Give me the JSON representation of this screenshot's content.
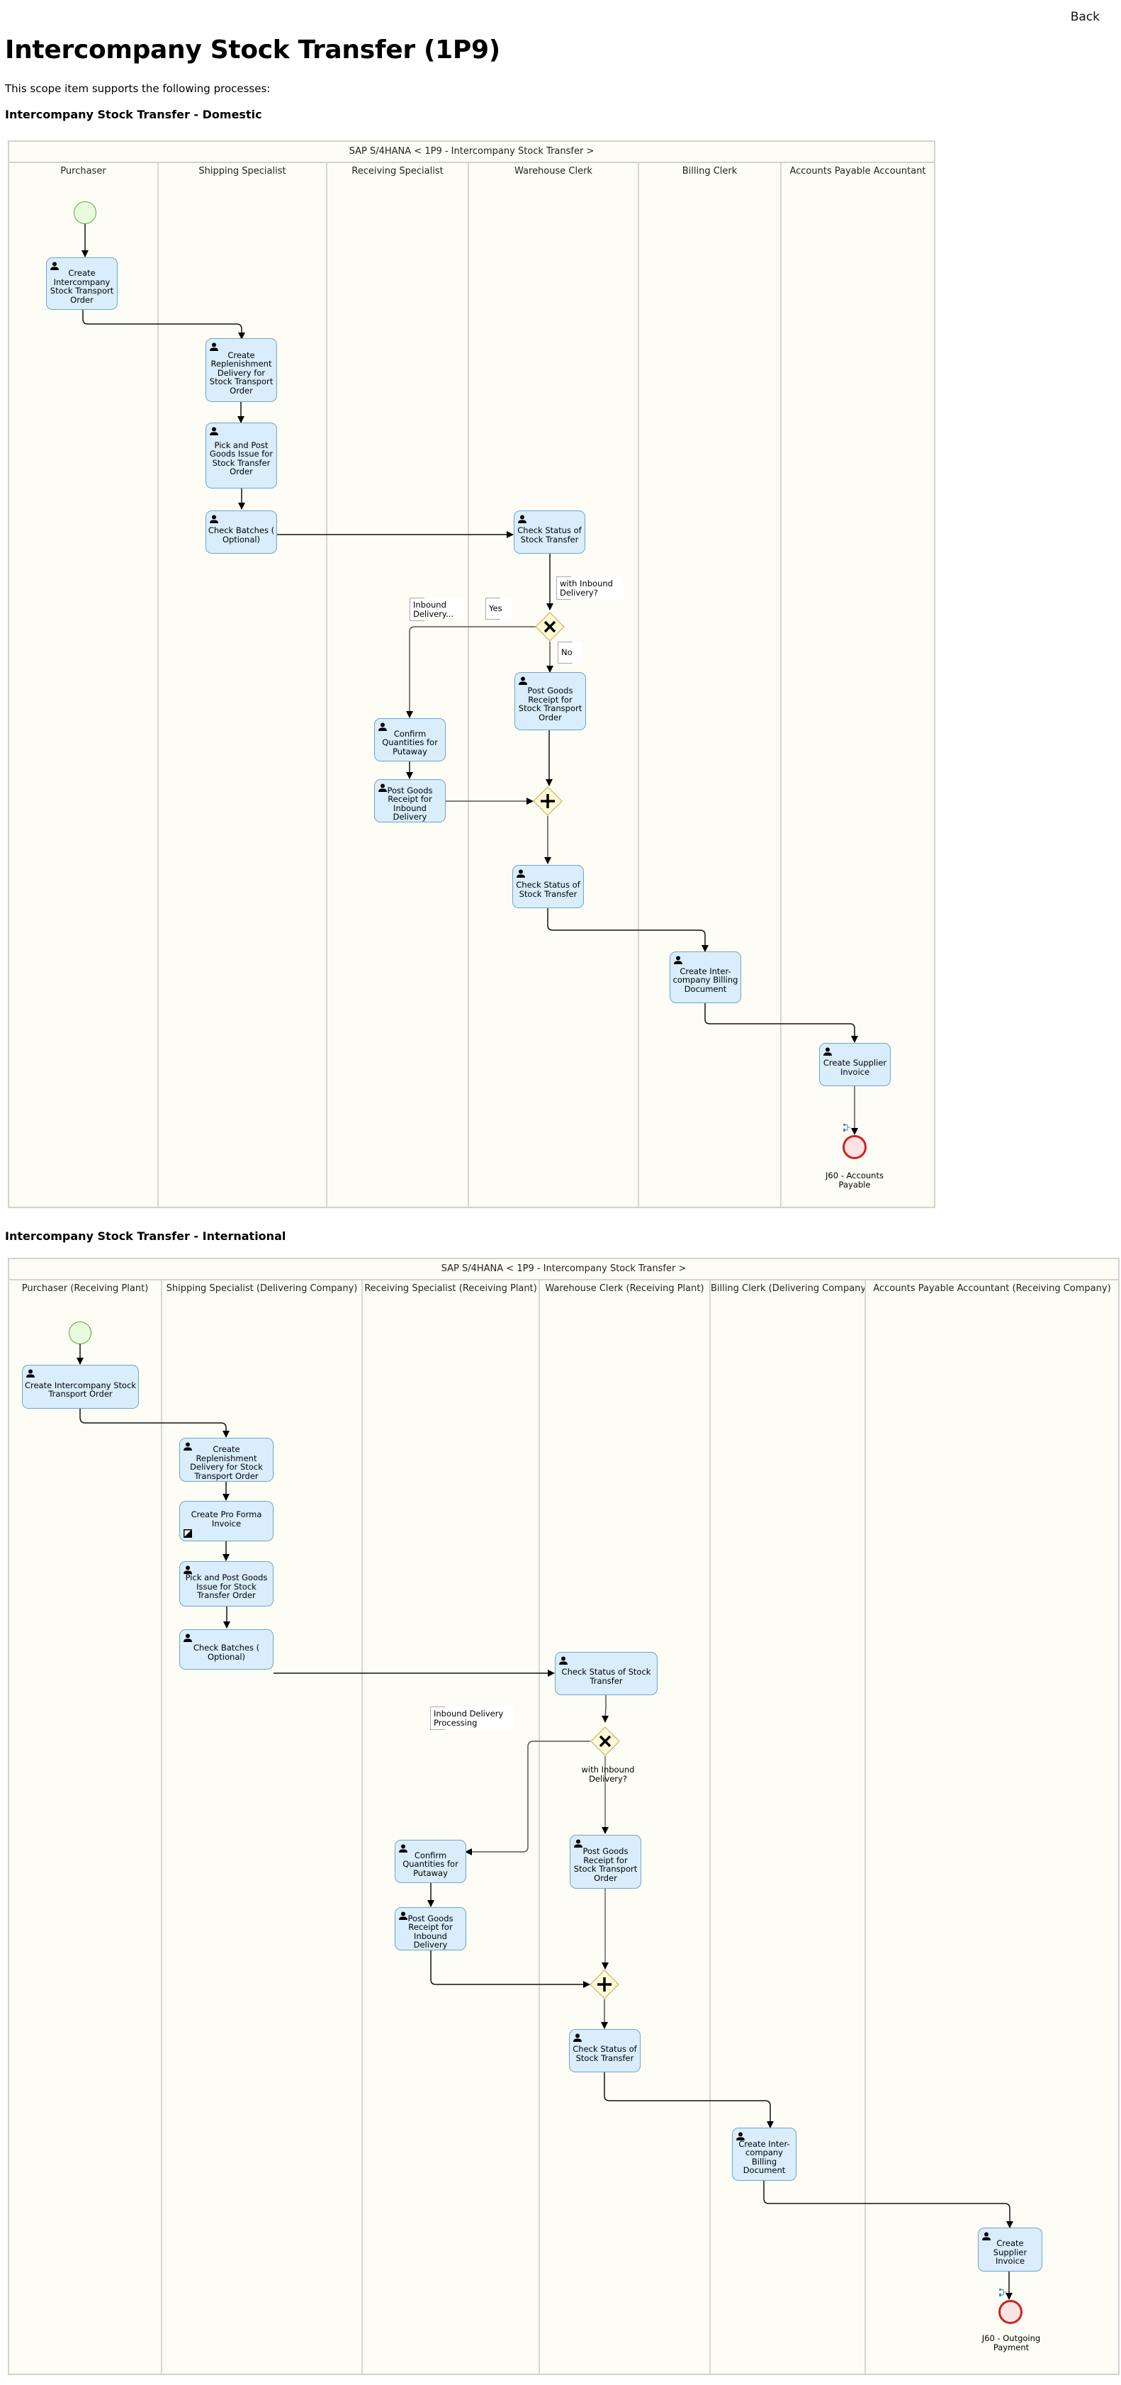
{
  "header": {
    "back_label": "Back",
    "title": "Intercompany Stock Transfer (1P9)",
    "intro": "This scope item supports the following processes:"
  },
  "colors": {
    "task_fill": "#d9edfc",
    "task_border": "#6fa6c4",
    "start_fill": "#e9fbdf",
    "start_border": "#5aa83a",
    "end_fill": "#fde3e3",
    "end_border": "#cc2222",
    "gateway_fill": "#fdfbd6",
    "gateway_border": "#c8b26a",
    "pool_bg": "#fdfdf5"
  },
  "domestic": {
    "section_title": "Intercompany Stock Transfer - Domestic",
    "pool_title": "SAP S/4HANA < 1P9 - Intercompany Stock Transfer >",
    "lanes": [
      "Purchaser",
      "Shipping Specialist",
      "Receiving Specialist",
      "Warehouse Clerk",
      "Billing Clerk",
      "Accounts Payable Accountant"
    ],
    "tasks": {
      "create_sto": "Create\nIntercompany\nStock Transport\nOrder",
      "create_replenishment": "Create\nReplenishment\nDelivery for\nStock Transport\nOrder",
      "pick_post_gi": "Pick and Post\nGoods Issue for\nStock Transfer\nOrder",
      "check_batches": "Check Batches (\nOptional)",
      "check_status_1": "Check Status of\nStock Transfer",
      "post_gr_sto": "Post Goods\nReceipt for\nStock Transport\nOrder",
      "confirm_quantities": "Confirm\nQuantities for\nPutaway",
      "post_gr_inbound": "Post Goods\nReceipt for\nInbound Delivery",
      "check_status_2": "Check Status of\nStock Transfer",
      "create_billing": "Create Inter-\ncompany Billing\nDocument",
      "create_supplier_invoice": "Create Supplier\nInvoice"
    },
    "annotations": {
      "with_inbound": "with Inbound\nDelivery?",
      "yes": "Yes",
      "no": "No",
      "inbound_delivery": "Inbound\nDelivery..."
    },
    "end_event_label": "J60 - Accounts\nPayable"
  },
  "international": {
    "section_title": "Intercompany Stock Transfer - International",
    "pool_title": "SAP S/4HANA < 1P9 - Intercompany Stock Transfer >",
    "lanes": [
      "Purchaser (Receiving Plant)",
      "Shipping Specialist (Delivering Company)",
      "Receiving Specialist (Receiving Plant)",
      "Warehouse Clerk (Receiving Plant)",
      "Billing Clerk (Delivering Company)",
      "Accounts Payable Accountant (Receiving Company)"
    ],
    "tasks": {
      "create_sto": "Create Intercompany Stock\nTransport Order",
      "create_replenishment": "Create\nReplenishment\nDelivery for Stock\nTransport Order",
      "create_pro_forma": "Create Pro Forma\nInvoice",
      "pick_post_gi": "Pick and Post Goods\nIssue for Stock\nTransfer Order",
      "check_batches": "Check Batches (\nOptional)",
      "check_status_1": "Check Status of Stock\nTransfer",
      "confirm_quantities": "Confirm\nQuantities for\nPutaway",
      "post_gr_sto": "Post Goods\nReceipt for\nStock Transport\nOrder",
      "post_gr_inbound": "Post Goods\nReceipt for\nInbound Delivery",
      "check_status_2": "Check Status of\nStock Transfer",
      "create_billing": "Create Inter-\ncompany Billing\nDocument",
      "create_supplier_invoice": "Create Supplier\nInvoice"
    },
    "annotations": {
      "inbound_processing": "Inbound Delivery\nProcessing"
    },
    "gateway_label": "with Inbound\nDelivery?",
    "end_event_label": "J60 - Outgoing\nPayment"
  }
}
